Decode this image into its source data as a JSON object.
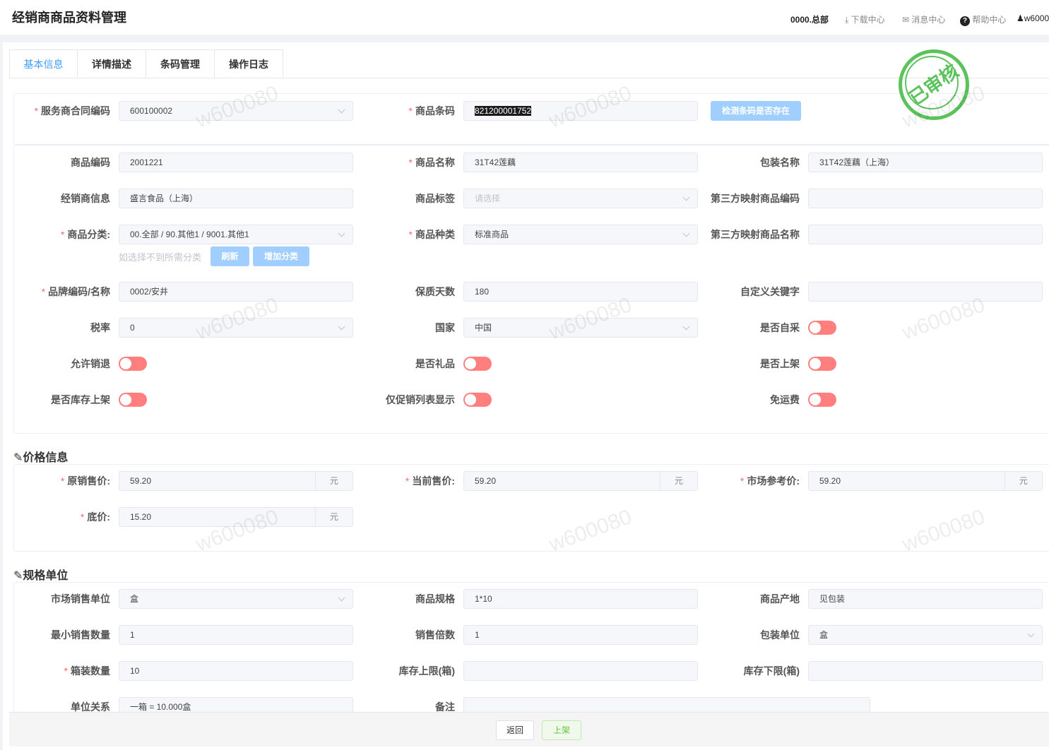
{
  "header": {
    "title": "经销商商品资料管理",
    "org": "0000.总部",
    "download": "下载中心",
    "messages": "消息中心",
    "help": "帮助中心",
    "user": "w6000"
  },
  "tabs": [
    "基本信息",
    "详情描述",
    "条码管理",
    "操作日志"
  ],
  "stamp": "已审核",
  "watermark": "w600080",
  "check_barcode_button": "检测条码是否存在",
  "category_hint": "如选择不到所需分类",
  "refresh_button": "刷新",
  "add_category_button": "增加分类",
  "sections": {
    "price": "价格信息",
    "spec": "规格单位"
  },
  "card1": [
    [
      {
        "label": "服务商合同编码",
        "value": "600100002",
        "type": "select",
        "required": true
      },
      {
        "label": "商品条码",
        "value": "821200001752",
        "type": "selected-text",
        "required": true
      },
      null
    ]
  ],
  "card2": [
    [
      {
        "label": "商品编码",
        "value": "2001221",
        "type": "input"
      },
      {
        "label": "商品名称",
        "value": "31T42莲藕",
        "type": "input",
        "required": true
      },
      {
        "label": "包装名称",
        "value": "31T42莲藕（上海）",
        "type": "input"
      }
    ],
    [
      {
        "label": "经销商信息",
        "value": "盛言食品（上海）",
        "type": "input"
      },
      {
        "label": "商品标签",
        "value": "请选择",
        "type": "select",
        "placeholder": true
      },
      {
        "label": "第三方映射商品编码",
        "value": "",
        "type": "input"
      }
    ],
    [
      {
        "label": "商品分类:",
        "value": "00.全部 / 90.其他1 / 9001.其他1",
        "type": "select",
        "required": true
      },
      {
        "label": "商品种类",
        "value": "标准商品",
        "type": "select",
        "required": true
      },
      {
        "label": "第三方映射商品名称",
        "value": "",
        "type": "input"
      }
    ],
    [
      {
        "label": "品牌编码/名称",
        "value": "0002/安井",
        "type": "input",
        "required": true
      },
      {
        "label": "保质天数",
        "value": "180",
        "type": "input"
      },
      {
        "label": "自定义关键字",
        "value": "",
        "type": "input"
      }
    ],
    [
      {
        "label": "税率",
        "value": "0",
        "type": "select"
      },
      {
        "label": "国家",
        "value": "中国",
        "type": "select"
      },
      {
        "label": "是否自采",
        "value": false,
        "type": "switch"
      }
    ],
    [
      {
        "label": "允许销退",
        "value": false,
        "type": "switch"
      },
      {
        "label": "是否礼品",
        "value": false,
        "type": "switch"
      },
      {
        "label": "是否上架",
        "value": false,
        "type": "switch"
      }
    ],
    [
      {
        "label": "是否库存上架",
        "value": false,
        "type": "switch"
      },
      {
        "label": "仅促销列表显示",
        "value": false,
        "type": "switch"
      },
      {
        "label": "免运费",
        "value": false,
        "type": "switch"
      }
    ]
  ],
  "price": [
    [
      {
        "label": "原销售价:",
        "value": "59.20",
        "unit": "元",
        "type": "unit",
        "required": true
      },
      {
        "label": "当前售价:",
        "value": "59.20",
        "unit": "元",
        "type": "unit",
        "required": true
      },
      {
        "label": "市场参考价:",
        "value": "59.20",
        "unit": "元",
        "type": "unit",
        "required": true
      }
    ],
    [
      {
        "label": "底价:",
        "value": "15.20",
        "unit": "元",
        "type": "unit",
        "required": true
      },
      null,
      null
    ]
  ],
  "spec": [
    [
      {
        "label": "市场销售单位",
        "value": "盒",
        "type": "select"
      },
      {
        "label": "商品规格",
        "value": "1*10",
        "type": "input"
      },
      {
        "label": "商品产地",
        "value": "见包装",
        "type": "input"
      }
    ],
    [
      {
        "label": "最小销售数量",
        "value": "1",
        "type": "input"
      },
      {
        "label": "销售倍数",
        "value": "1",
        "type": "input"
      },
      {
        "label": "包装单位",
        "value": "盒",
        "type": "select"
      }
    ],
    [
      {
        "label": "箱装数量",
        "value": "10",
        "type": "input",
        "required": true
      },
      {
        "label": "库存上限(箱)",
        "value": "",
        "type": "input"
      },
      {
        "label": "库存下限(箱)",
        "value": "",
        "type": "input"
      }
    ],
    [
      {
        "label": "单位关系",
        "value": "一箱 = 10.000盒",
        "type": "input"
      },
      {
        "label": "备注",
        "value": "",
        "type": "wide"
      },
      null
    ]
  ],
  "footer": {
    "back": "返回",
    "publish": "上架"
  }
}
